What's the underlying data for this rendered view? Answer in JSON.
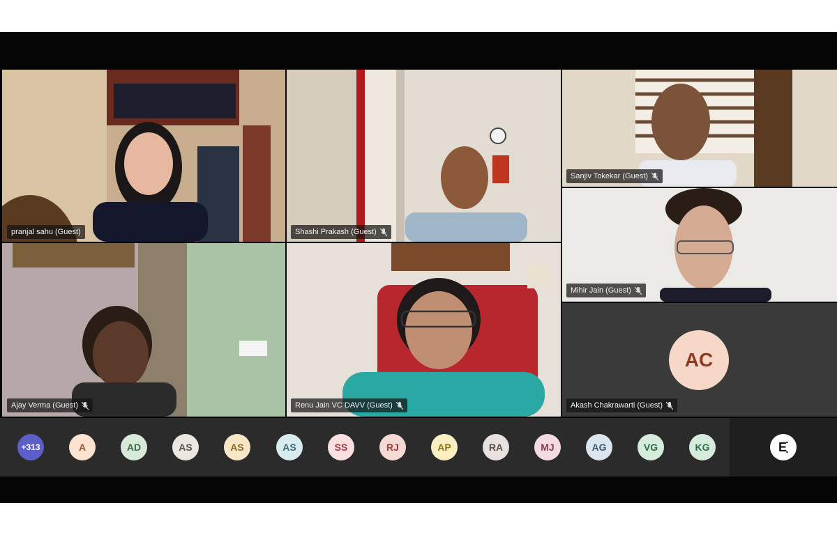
{
  "participants": [
    {
      "name": "pranjal sahu (Guest)",
      "muted": false
    },
    {
      "name": "Shashi Prakash (Guest)",
      "muted": true
    },
    {
      "name": "Sanjiv Tokekar (Guest)",
      "muted": true
    },
    {
      "name": "Mihir Jain (Guest)",
      "muted": true
    },
    {
      "name": "Ajay Verma (Guest)",
      "muted": true
    },
    {
      "name": "Renu Jain VC DAVV (Guest)",
      "muted": true
    },
    {
      "name": "Akash Chakrawarti (Guest)",
      "muted": true,
      "initials": "AC"
    }
  ],
  "strip": {
    "overflow": "+313",
    "avatars": [
      "A",
      "AD",
      "AS",
      "AS",
      "AS",
      "SS",
      "RJ",
      "AP",
      "RA",
      "MJ",
      "AG",
      "VG",
      "KG"
    ],
    "logo": "E"
  },
  "colors": {
    "overflow_bg": "#5b5fc7",
    "avatar_bgs": [
      "#fbe3cf",
      "#d7e9d9",
      "#ece6e2",
      "#f6e6c6",
      "#d8ebef",
      "#fadfe1",
      "#f5d9d4",
      "#fbefc1",
      "#e7e2df",
      "#f3dbe0",
      "#dbe5ee",
      "#d5ecdd",
      "#d7ebdd"
    ],
    "avatar_fgs": [
      "#a0572a",
      "#3f6b46",
      "#5c524d",
      "#8d6a22",
      "#3f6b73",
      "#a4373f",
      "#9b3f34",
      "#8f7418",
      "#5b4f48",
      "#8c3c52",
      "#3f5a75",
      "#2f6e43",
      "#336e47"
    ]
  }
}
